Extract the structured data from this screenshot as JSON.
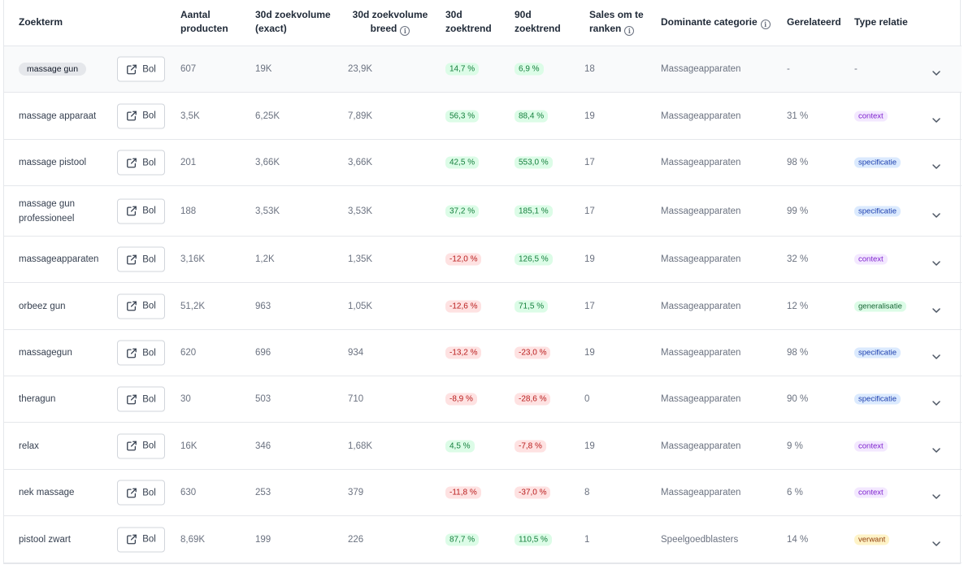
{
  "columns": {
    "zoekterm": "Zoekterm",
    "aantal_1": "Aantal",
    "aantal_2": "producten",
    "zv_exact_1": "30d zoekvolume",
    "zv_exact_2": "(exact)",
    "zv_breed_1": "30d zoekvolume",
    "zv_breed_2": "breed",
    "trend30_1": "30d",
    "trend30_2": "zoektrend",
    "trend90_1": "90d",
    "trend90_2": "zoektrend",
    "sales_1": "Sales om te",
    "sales_2": "ranken",
    "categorie": "Dominante categorie",
    "gerelateerd": "Gerelateerd",
    "type": "Type relatie"
  },
  "bol_label": "Bol",
  "icons": {
    "external": "external-link-icon",
    "info": "info-icon",
    "chevron": "chevron-down-icon"
  },
  "colors": {
    "up_bg": "#dcfce7",
    "up_fg": "#15803d",
    "down_bg": "#fee2e2",
    "down_fg": "#b91c1c"
  },
  "rows": [
    {
      "term": "massage gun",
      "aantal": "607",
      "exact": "19K",
      "breed": "23,9K",
      "t30": "14,7 %",
      "t30_dir": "up",
      "t90": "6,9 %",
      "t90_dir": "up",
      "sales": "18",
      "categorie": "Massageapparaten",
      "gerelateerd": "-",
      "type": "-"
    },
    {
      "term": "massage apparaat",
      "aantal": "3,5K",
      "exact": "6,25K",
      "breed": "7,89K",
      "t30": "56,3 %",
      "t30_dir": "up",
      "t90": "88,4 %",
      "t90_dir": "up",
      "sales": "19",
      "categorie": "Massageapparaten",
      "gerelateerd": "31 %",
      "type": "context"
    },
    {
      "term": "massage pistool",
      "aantal": "201",
      "exact": "3,66K",
      "breed": "3,66K",
      "t30": "42,5 %",
      "t30_dir": "up",
      "t90": "553,0 %",
      "t90_dir": "up",
      "sales": "17",
      "categorie": "Massageapparaten",
      "gerelateerd": "98 %",
      "type": "specificatie"
    },
    {
      "term": "massage gun professioneel",
      "aantal": "188",
      "exact": "3,53K",
      "breed": "3,53K",
      "t30": "37,2 %",
      "t30_dir": "up",
      "t90": "185,1 %",
      "t90_dir": "up",
      "sales": "17",
      "categorie": "Massageapparaten",
      "gerelateerd": "99 %",
      "type": "specificatie"
    },
    {
      "term": "massageapparaten",
      "aantal": "3,16K",
      "exact": "1,2K",
      "breed": "1,35K",
      "t30": "-12,0 %",
      "t30_dir": "down",
      "t90": "126,5 %",
      "t90_dir": "up",
      "sales": "19",
      "categorie": "Massageapparaten",
      "gerelateerd": "32 %",
      "type": "context"
    },
    {
      "term": "orbeez gun",
      "aantal": "51,2K",
      "exact": "963",
      "breed": "1,05K",
      "t30": "-12,6 %",
      "t30_dir": "down",
      "t90": "71,5 %",
      "t90_dir": "up",
      "sales": "17",
      "categorie": "Massageapparaten",
      "gerelateerd": "12 %",
      "type": "generalisatie"
    },
    {
      "term": "massagegun",
      "aantal": "620",
      "exact": "696",
      "breed": "934",
      "t30": "-13,2 %",
      "t30_dir": "down",
      "t90": "-23,0 %",
      "t90_dir": "down",
      "sales": "19",
      "categorie": "Massageapparaten",
      "gerelateerd": "98 %",
      "type": "specificatie"
    },
    {
      "term": "theragun",
      "aantal": "30",
      "exact": "503",
      "breed": "710",
      "t30": "-8,9 %",
      "t30_dir": "down",
      "t90": "-28,6 %",
      "t90_dir": "down",
      "sales": "0",
      "categorie": "Massageapparaten",
      "gerelateerd": "90 %",
      "type": "specificatie"
    },
    {
      "term": "relax",
      "aantal": "16K",
      "exact": "346",
      "breed": "1,68K",
      "t30": "4,5 %",
      "t30_dir": "up",
      "t90": "-7,8 %",
      "t90_dir": "down",
      "sales": "19",
      "categorie": "Massageapparaten",
      "gerelateerd": "9 %",
      "type": "context"
    },
    {
      "term": "nek massage",
      "aantal": "630",
      "exact": "253",
      "breed": "379",
      "t30": "-11,8 %",
      "t30_dir": "down",
      "t90": "-37,0 %",
      "t90_dir": "down",
      "sales": "8",
      "categorie": "Massageapparaten",
      "gerelateerd": "6 %",
      "type": "context"
    },
    {
      "term": "pistool zwart",
      "aantal": "8,69K",
      "exact": "199",
      "breed": "226",
      "t30": "87,7 %",
      "t30_dir": "up",
      "t90": "110,5 %",
      "t90_dir": "up",
      "sales": "1",
      "categorie": "Speelgoedblasters",
      "gerelateerd": "14 %",
      "type": "verwant"
    }
  ]
}
